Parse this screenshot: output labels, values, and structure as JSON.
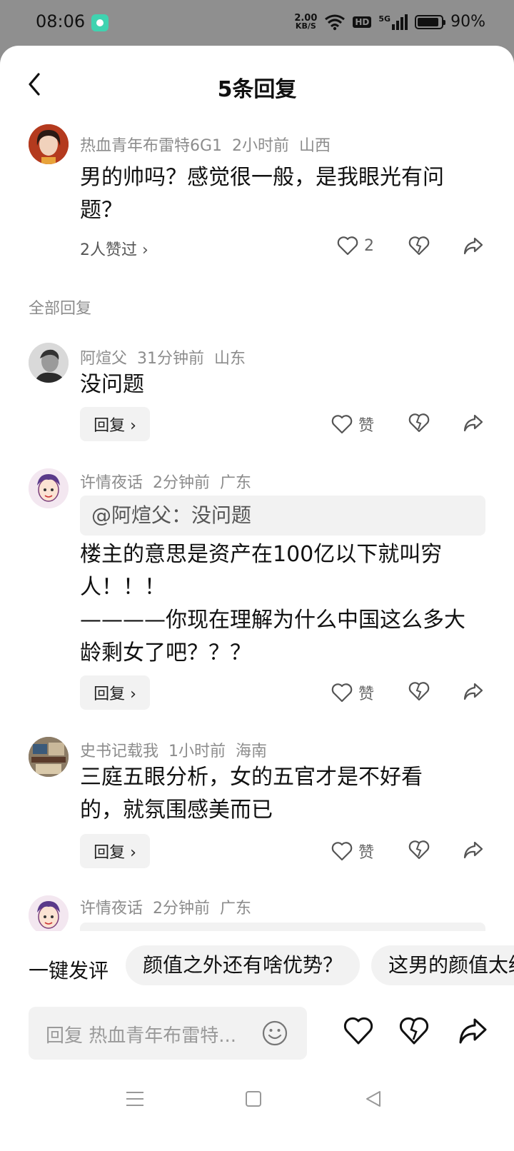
{
  "status_bar": {
    "time": "08:06",
    "speed_value": "2.00",
    "speed_unit": "KB/S",
    "hd": "HD",
    "network": "5G",
    "battery": "90%"
  },
  "header": {
    "title": "5条回复"
  },
  "main_comment": {
    "user": "热血青年布雷特6G1",
    "time": "2小时前",
    "location": "山西",
    "text": "男的帅吗？感觉很一般，是我眼光有问题？",
    "likes_link": "2人赞过 ›",
    "like_count": "2"
  },
  "section_label": "全部回复",
  "replies": [
    {
      "user": "阿煊父",
      "time": "31分钟前",
      "location": "山东",
      "text": "没问题",
      "reply_label": "回复 ›",
      "like_label": "赞"
    },
    {
      "user": "许情夜话",
      "time": "2分钟前",
      "location": "广东",
      "quote": "@阿煊父：没问题",
      "text_lines": [
        "楼主的意思是资产在100亿以下就叫穷",
        "人！！！",
        "————你现在理解为什么中国这么多大",
        "龄剩女了吧？？？"
      ],
      "reply_label": "回复 ›",
      "like_label": "赞"
    },
    {
      "user": "史书记载我",
      "time": "1小时前",
      "location": "海南",
      "text_lines": [
        "三庭五眼分析，女的五官才是不好看",
        "的，就氛围感美而已"
      ],
      "reply_label": "回复 ›",
      "like_label": "赞"
    },
    {
      "user": "许情夜话",
      "time": "2分钟前",
      "location": "广东"
    }
  ],
  "bottom": {
    "quick_label": "一键发评",
    "chips": [
      "颜值之外还有啥优势？",
      "这男的颜值太绝"
    ],
    "input_placeholder": "回复 热血青年布雷特..."
  },
  "icons": {
    "back": "chevron-left-icon",
    "like": "heart-icon",
    "dislike": "broken-heart-icon",
    "share": "share-arrow-icon",
    "emoji": "smiley-icon",
    "nav_menu": "menu-icon",
    "nav_home": "square-icon",
    "nav_back": "triangle-back-icon"
  }
}
